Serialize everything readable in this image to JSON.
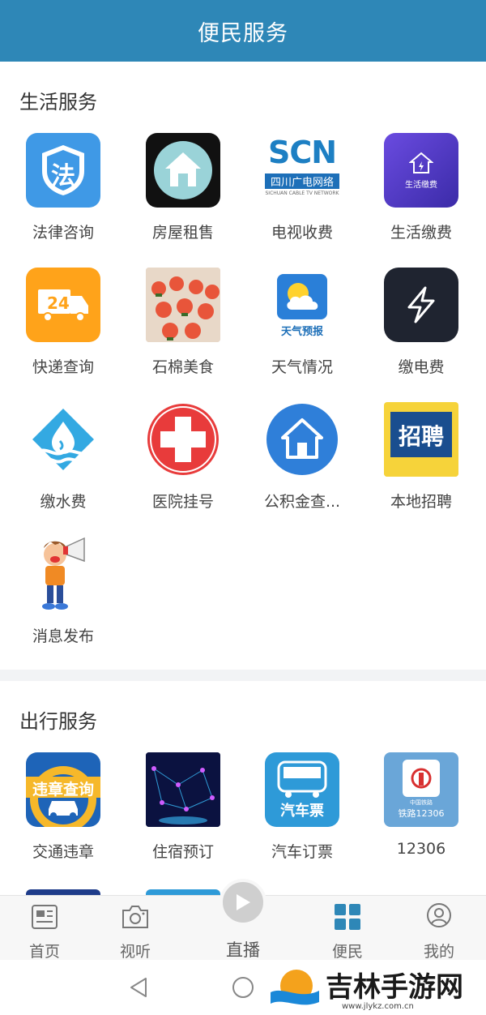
{
  "header": {
    "title": "便民服务"
  },
  "life_section": {
    "title": "生活服务",
    "items": [
      {
        "label": "法律咨询",
        "icon": "law-shield-icon",
        "icon_text": "法"
      },
      {
        "label": "房屋租售",
        "icon": "house-icon"
      },
      {
        "label": "电视收费",
        "icon": "scn-tv-logo-icon",
        "icon_text": "SCN",
        "icon_sub": "四川广电网络",
        "icon_sub2": "SICHUAN CABLE TV NETWORK"
      },
      {
        "label": "生活缴费",
        "icon": "life-payment-icon",
        "icon_text": "生活缴费"
      },
      {
        "label": "快递查询",
        "icon": "delivery-truck-icon",
        "icon_text": "24"
      },
      {
        "label": "石棉美食",
        "icon": "food-photo-icon"
      },
      {
        "label": "天气情况",
        "icon": "weather-forecast-icon",
        "icon_text": "天气预报"
      },
      {
        "label": "缴电费",
        "icon": "lightning-icon"
      },
      {
        "label": "缴水费",
        "icon": "water-drop-icon"
      },
      {
        "label": "医院挂号",
        "icon": "red-cross-icon"
      },
      {
        "label": "公积金查...",
        "icon": "housing-fund-icon"
      },
      {
        "label": "本地招聘",
        "icon": "recruitment-icon",
        "icon_text": "招聘"
      },
      {
        "label": "消息发布",
        "icon": "megaphone-boy-icon"
      }
    ]
  },
  "travel_section": {
    "title": "出行服务",
    "items": [
      {
        "label": "交通违章",
        "icon": "traffic-violation-icon",
        "icon_text": "违章查询"
      },
      {
        "label": "住宿预订",
        "icon": "hotel-booking-icon"
      },
      {
        "label": "汽车订票",
        "icon": "bus-ticket-icon",
        "icon_text": "汽车票"
      },
      {
        "label": "12306",
        "icon": "railway-12306-icon",
        "icon_text": "铁路12306",
        "icon_sub": "中国铁路"
      }
    ]
  },
  "tabbar": {
    "tabs": [
      {
        "label": "首页",
        "icon": "home-news-icon"
      },
      {
        "label": "视听",
        "icon": "camera-icon"
      },
      {
        "label": "直播",
        "icon": "play-icon"
      },
      {
        "label": "便民",
        "icon": "grid-icon",
        "active": true
      },
      {
        "label": "我的",
        "icon": "user-icon"
      }
    ]
  },
  "watermark": {
    "text": "吉林手游网",
    "url": "www.jlykz.com.cn"
  },
  "colors": {
    "header": "#2e87b7",
    "active_tab": "#2e87b7"
  }
}
